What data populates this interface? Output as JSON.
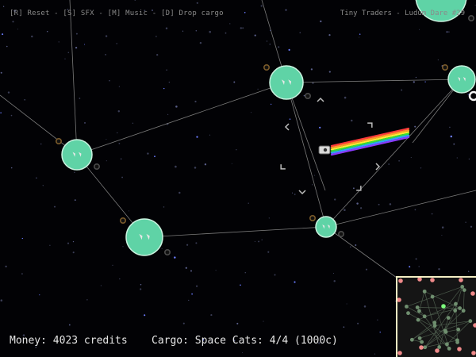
{
  "hud": {
    "controls": "[R] Reset - [S] SFX - [M] Music - [D] Drop cargo",
    "title": "Tiny Traders - Ludum Dare #29",
    "money": "Money: 4023 credits",
    "cargo": "Cargo: Space Cats: 4/4 (1000c)"
  },
  "colors": {
    "planet_fill": "#5fd3a6",
    "planet_stroke": "#c9f2df",
    "route_line": "#7a7a7a",
    "minimap_border": "#f4efc4",
    "minimap_planet": "#6f8f6f",
    "minimap_station": "#f08a8a",
    "player_marker": "#7dff7d",
    "rainbow": [
      "#ff3b3b",
      "#ff9b2b",
      "#ffee33",
      "#33e03b",
      "#33a0ff",
      "#8a3bff"
    ]
  },
  "icons": [
    "planet-icon",
    "spaceship-icon",
    "dock-port-icon",
    "target-bracket-icon",
    "rainbow-trail-icon",
    "minimap-icon"
  ]
}
